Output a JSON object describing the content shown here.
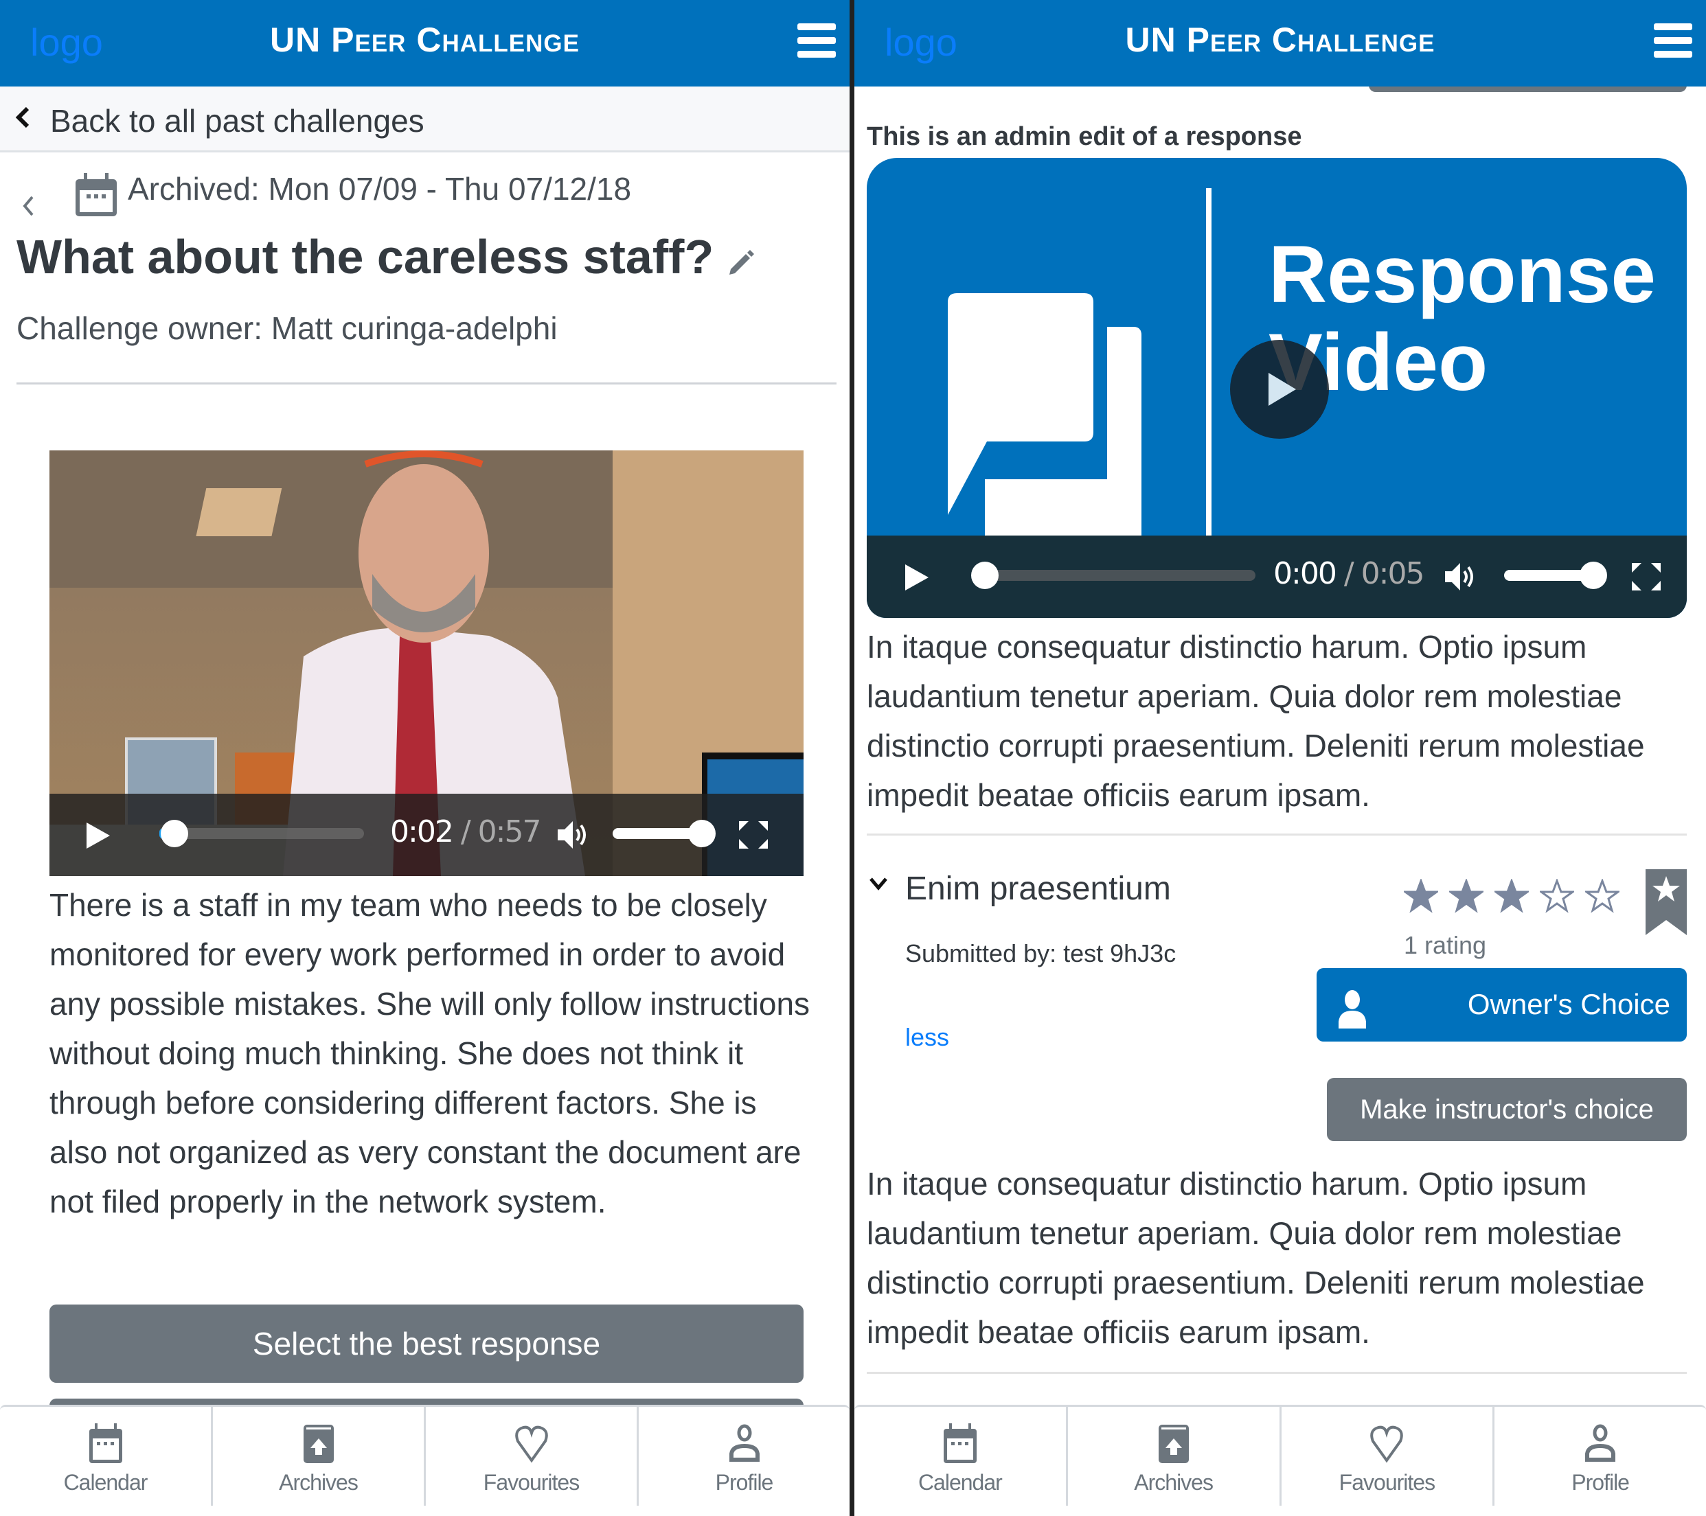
{
  "app": {
    "logo_text": "logo",
    "title": "UN Peer Challenge",
    "brand_color": "#0071bc",
    "menu_icon": "hamburger-menu-icon"
  },
  "left": {
    "back_link": "Back to all past challenges",
    "archived": "Archived: Mon 07/09 - Thu 07/12/18",
    "challenge_title": "What about the careless staff?",
    "owner": "Challenge owner: Matt curinga-adelphi",
    "video": {
      "current_time": "0:02",
      "separator": "/",
      "duration": "0:57",
      "progress": 0.035,
      "volume": 1.0
    },
    "description": "There is a staff in my team who needs to be closely monitored for every work performed in order to avoid any possible mistakes. She will only follow instructions without doing much thinking. She does not think it through before considering different factors. She is also not organized as very constant the document are not filed properly in the network system.",
    "select_button": "Select the best response"
  },
  "right": {
    "admin_note": "This is an admin edit of a response",
    "video": {
      "poster_line1": "Response",
      "poster_line2": "Video",
      "current_time": "0:00",
      "separator": "/",
      "duration": "0:05",
      "progress": 0.0,
      "volume": 1.0
    },
    "response_body": "In itaque consequatur distinctio harum. Optio ipsum laudantium tenetur aperiam. Quia dolor rem molestiae distinctio corrupti praesentium. Deleniti rerum molestiae impedit beatae officiis earum ipsam.",
    "response": {
      "title": "Enim praesentium",
      "submitted_by": "Submitted by: test 9hJ3c",
      "less_link": "less",
      "rating": 3,
      "max_rating": 5,
      "rating_count": "1 rating",
      "owners_choice": "Owner's Choice",
      "instructor_choice": "Make instructor's choice",
      "body": "In itaque consequatur distinctio harum. Optio ipsum laudantium tenetur aperiam. Quia dolor rem molestiae distinctio corrupti praesentium. Deleniti rerum molestiae impedit beatae officiis earum ipsam."
    }
  },
  "bottom_nav": [
    {
      "label": "Calendar",
      "icon": "calendar-icon"
    },
    {
      "label": "Archives",
      "icon": "archive-icon"
    },
    {
      "label": "Favourites",
      "icon": "heart-icon"
    },
    {
      "label": "Profile",
      "icon": "profile-icon"
    }
  ]
}
